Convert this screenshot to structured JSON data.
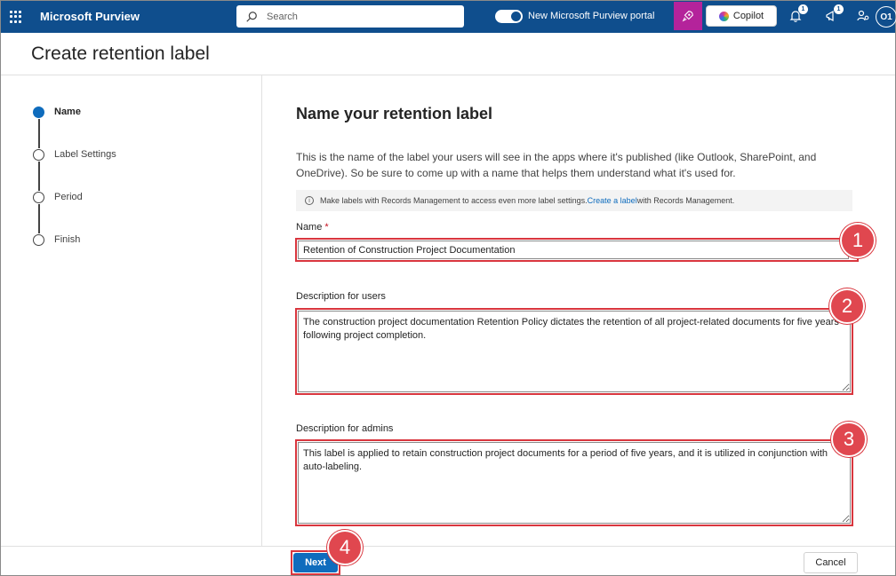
{
  "topbar": {
    "app_title": "Microsoft Purview",
    "search_placeholder": "Search",
    "portal_toggle_label": "New Microsoft Purview portal",
    "portal_toggle_on": true,
    "copilot_label": "Copilot",
    "notifications_badge": "1",
    "whats_new_badge": "1",
    "avatar_initials": "O1",
    "brand_color": "#0f4e8d"
  },
  "header": {
    "title": "Create retention label"
  },
  "steps": [
    {
      "label": "Name",
      "active": true
    },
    {
      "label": "Label Settings",
      "active": false
    },
    {
      "label": "Period",
      "active": false
    },
    {
      "label": "Finish",
      "active": false
    }
  ],
  "main": {
    "title": "Name your retention label",
    "intro": "This is the name of the label your users will see in the apps where it's published (like Outlook, SharePoint, and OneDrive). So be sure to come up with a name that helps them understand what it's used for.",
    "info": {
      "text_before": "Make labels with Records Management to access even more label settings. ",
      "link": "Create a label",
      "text_after": " with Records Management."
    },
    "name_label": "Name",
    "required_mark": "*",
    "name_value": "Retention of Construction Project Documentation",
    "desc_users_label": "Description for users",
    "desc_users_value": "The construction project documentation Retention Policy dictates the retention of all project-related documents for five years following project completion.",
    "desc_admins_label": "Description for admins",
    "desc_admins_value": "This label is applied to retain construction project documents for a period of five years, and it is utilized in conjunction with auto-labeling."
  },
  "callouts": [
    "1",
    "2",
    "3",
    "4"
  ],
  "footer": {
    "next_label": "Next",
    "cancel_label": "Cancel"
  },
  "colors": {
    "accent": "#0f6cbd",
    "highlight": "#d9363e"
  }
}
